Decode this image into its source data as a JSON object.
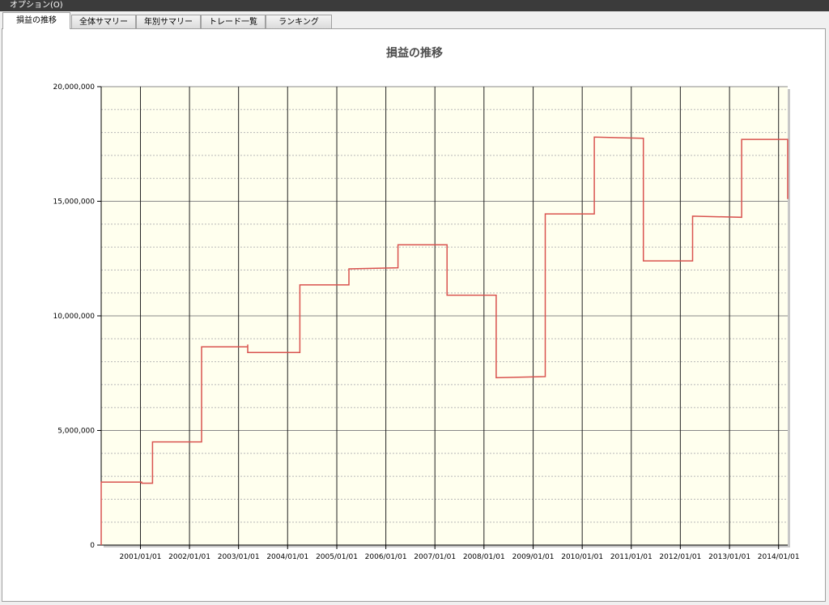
{
  "menubar": {
    "options": "オプション(O)"
  },
  "tabs": [
    {
      "label": "損益の推移",
      "active": true
    },
    {
      "label": "全体サマリー",
      "active": false
    },
    {
      "label": "年別サマリー",
      "active": false
    },
    {
      "label": "トレード一覧",
      "active": false
    },
    {
      "label": "ランキング",
      "active": false
    }
  ],
  "chart_data": {
    "type": "line",
    "title": "損益の推移",
    "xlabel": "",
    "ylabel": "",
    "ylim": [
      0,
      20000000
    ],
    "xlim": [
      "2000/03/15",
      "2014/03/10"
    ],
    "grid": true,
    "background_color": "#ffffee",
    "line_color": "#d9534f",
    "y_ticks": [
      "0",
      "5,000,000",
      "10,000,000",
      "15,000,000",
      "20,000,000"
    ],
    "y_tick_values": [
      0,
      5000000,
      10000000,
      15000000,
      20000000
    ],
    "x_ticks": [
      "2001/01/01",
      "2002/01/01",
      "2003/01/01",
      "2004/01/01",
      "2005/01/01",
      "2006/01/01",
      "2007/01/01",
      "2008/01/01",
      "2009/01/01",
      "2010/01/01",
      "2011/01/01",
      "2012/01/01",
      "2013/01/01",
      "2014/01/01"
    ],
    "series": [
      {
        "x": [
          "2000/03/15",
          "2000/03/15",
          "2001/01/10",
          "2001/01/10",
          "2001/04/01",
          "2001/04/01",
          "2002/01/01",
          "2002/01/01",
          "2002/04/01",
          "2002/04/01",
          "2003/03/10",
          "2003/03/10",
          "2003/03/10",
          "2003/03/10",
          "2004/04/01",
          "2004/04/01",
          "2005/03/20",
          "2005/03/20",
          "2005/04/01",
          "2005/04/01",
          "2006/04/01",
          "2006/04/01",
          "2007/04/01",
          "2007/04/01",
          "2008/04/01",
          "2008/04/01",
          "2009/04/01",
          "2009/04/01",
          "2010/04/01",
          "2010/04/01",
          "2011/04/01",
          "2011/04/01",
          "2012/04/01",
          "2012/04/01",
          "2013/04/01",
          "2013/04/01",
          "2014/03/10",
          "2014/03/10"
        ],
        "y": [
          0,
          2750000,
          2750000,
          2700000,
          2700000,
          4500000,
          4500000,
          4500000,
          4500000,
          8650000,
          8650000,
          8750000,
          8400000,
          8400000,
          8400000,
          11350000,
          11350000,
          11350000,
          11350000,
          12050000,
          12100000,
          13100000,
          13100000,
          10900000,
          10900000,
          7300000,
          7350000,
          14450000,
          14450000,
          17800000,
          17750000,
          12400000,
          12400000,
          14350000,
          14300000,
          17700000,
          17700000,
          15100000
        ]
      }
    ]
  }
}
